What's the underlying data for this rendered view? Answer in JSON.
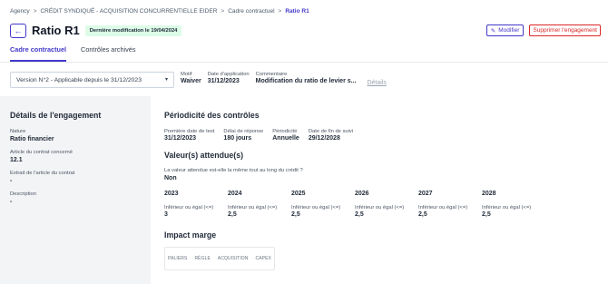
{
  "breadcrumb": {
    "items": [
      "Agency",
      "CRÉDIT SYNDIQUÉ - ACQUISITION CONCURRENTIELLE EIDER",
      "Cadre contractuel"
    ],
    "current": "Ratio R1",
    "separator": ">"
  },
  "header": {
    "back_icon": "←",
    "title": "Ratio R1",
    "badge": "Dernière modification le 19/04/2024",
    "edit_icon": "✎",
    "edit_label": "Modifier",
    "delete_label": "Supprimer l'engagement"
  },
  "tabs": [
    {
      "label": "Cadre contractuel",
      "active": true
    },
    {
      "label": "Contrôles archivés",
      "active": false
    }
  ],
  "filters": {
    "version_select": "Version N°2 - Applicable depuis le 31/12/2023",
    "chevron": "▾",
    "motif_label": "Motif",
    "motif_value": "Waiver",
    "date_label": "Date d'application",
    "date_value": "31/12/2023",
    "comment_label": "Commentaire",
    "comment_value": "Modification du ratio de levier s...",
    "details_link": "Détails"
  },
  "engagement": {
    "title": "Détails de l'engagement",
    "fields": [
      {
        "label": "Nature",
        "value": "Ratio financier"
      },
      {
        "label": "Article du contrat concerné",
        "value": "12.1"
      },
      {
        "label": "Extrait de l'article du contrat",
        "value": "-"
      },
      {
        "label": "Description",
        "value": "-"
      }
    ]
  },
  "periodicite": {
    "title": "Périodicité des contrôles",
    "cols": [
      {
        "label": "Première date de test",
        "value": "31/12/2023"
      },
      {
        "label": "Délai de réponse",
        "value": "180 jours"
      },
      {
        "label": "Périodicité",
        "value": "Annuelle"
      },
      {
        "label": "Date de fin de suivi",
        "value": "29/12/2028"
      }
    ]
  },
  "valeurs": {
    "title": "Valeur(s) attendue(s)",
    "question": "La valeur attendue est-elle la même tout au long du crédit ?",
    "answer": "Non",
    "years": [
      {
        "year": "2023",
        "comparator": "Inférieur ou égal (<=)",
        "value": "3"
      },
      {
        "year": "2024",
        "comparator": "Inférieur ou égal (<=)",
        "value": "2,5"
      },
      {
        "year": "2025",
        "comparator": "Inférieur ou égal (<=)",
        "value": "2,5"
      },
      {
        "year": "2026",
        "comparator": "Inférieur ou égal (<=)",
        "value": "2,5"
      },
      {
        "year": "2027",
        "comparator": "Inférieur ou égal (<=)",
        "value": "2,5"
      },
      {
        "year": "2028",
        "comparator": "Inférieur ou égal (<=)",
        "value": "2,5"
      }
    ]
  },
  "impact": {
    "title": "Impact marge",
    "columns": [
      "PALIERS",
      "RÈGLE",
      "ACQUISITION",
      "CAPEX"
    ]
  },
  "colors": {
    "accent": "#4338ca",
    "danger": "#dc2626",
    "badge_bg": "#dcfce7",
    "panel_bg": "#f3f4f6"
  }
}
